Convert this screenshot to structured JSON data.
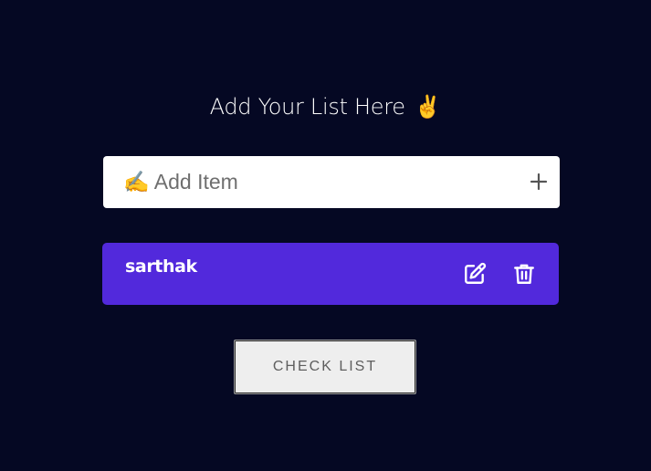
{
  "header": {
    "title": "Add Your List Here",
    "title_emoji": "✌️"
  },
  "add_item": {
    "placeholder": "✍️ Add Item",
    "value": "",
    "add_icon": "plus-icon"
  },
  "items": [
    {
      "text": "sarthak",
      "actions": [
        "edit-icon",
        "trash-icon"
      ]
    }
  ],
  "check_button": {
    "label": "CHECK LIST"
  },
  "colors": {
    "background": "#050823",
    "item_background": "#5229dc",
    "input_background": "#ffffff",
    "button_background": "#eeeeee"
  }
}
